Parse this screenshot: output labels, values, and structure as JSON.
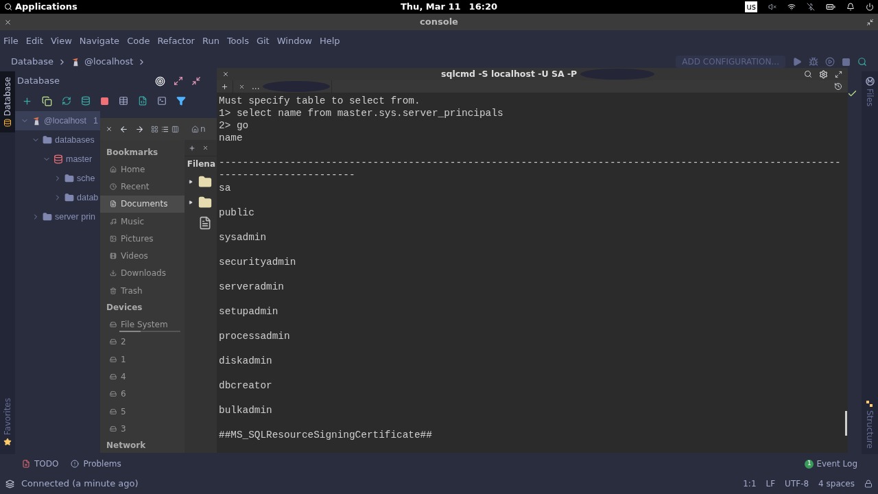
{
  "top_bar": {
    "menu": "Applications",
    "date": "Thu, Mar 11",
    "time": "16:20",
    "keyboard": "us"
  },
  "window": {
    "title": "console"
  },
  "menu": [
    "File",
    "Edit",
    "View",
    "Navigate",
    "Code",
    "Refactor",
    "Run",
    "Tools",
    "Git",
    "Window",
    "Help"
  ],
  "breadcrumb": [
    "Database",
    "@localhost"
  ],
  "run_config": "ADD CONFIGURATION...",
  "left_strip": {
    "top": {
      "label": "Database",
      "selected": true
    },
    "bottom": {
      "label": "Favorites",
      "selected": false
    }
  },
  "right_strip": [
    "Files",
    "Structure"
  ],
  "db_panel": {
    "title": "Database",
    "tree": [
      {
        "kind": "host",
        "label": "@localhost",
        "badge": "1",
        "expanded": true,
        "selected": true,
        "children": [
          {
            "kind": "folder",
            "label": "databases",
            "expanded": true,
            "selected": false,
            "children": [
              {
                "kind": "database",
                "label": "master",
                "expanded": true,
                "selected": false,
                "children": [
                  {
                    "kind": "folder",
                    "label": "sche",
                    "expanded": false,
                    "selected": false
                  },
                  {
                    "kind": "folder",
                    "label": "datab",
                    "expanded": false,
                    "selected": false
                  }
                ]
              }
            ]
          },
          {
            "kind": "folder",
            "label": "server prin",
            "expanded": false,
            "selected": false
          }
        ]
      }
    ]
  },
  "file_manager": {
    "path": "n",
    "column": "Filena",
    "sections": [
      {
        "title": "Bookmarks",
        "items": [
          {
            "label": "Home",
            "selected": false
          },
          {
            "label": "Recent",
            "selected": false
          },
          {
            "label": "Documents",
            "selected": true
          },
          {
            "label": "Music",
            "selected": false
          },
          {
            "label": "Pictures",
            "selected": false
          },
          {
            "label": "Videos",
            "selected": false
          },
          {
            "label": "Downloads",
            "selected": false
          },
          {
            "label": "Trash",
            "selected": false
          }
        ]
      },
      {
        "title": "Devices",
        "items": [
          {
            "label": "File System",
            "selected": false,
            "level": 0.35
          },
          {
            "label": "2",
            "selected": false
          },
          {
            "label": "1",
            "selected": false
          },
          {
            "label": "4",
            "selected": false
          },
          {
            "label": "6",
            "selected": false
          },
          {
            "label": "5",
            "selected": false
          },
          {
            "label": "3",
            "selected": false
          }
        ]
      },
      {
        "title": "Network"
      }
    ],
    "rows": [
      {
        "kind": "folder",
        "expandable": true
      },
      {
        "kind": "folder",
        "expandable": true
      },
      {
        "kind": "document",
        "expandable": false
      }
    ]
  },
  "terminal": {
    "title": "sqlcmd -S localhost -U SA -P",
    "tab": "...",
    "lines": [
      "Must specify table to select from.",
      "1> select name from master.sys.server_principals",
      "2> go",
      "name"
    ],
    "rule": "--------------------------------------------------------------------------------------------------------------------------------",
    "rows": [
      "sa",
      "public",
      "sysadmin",
      "securityadmin",
      "serveradmin",
      "setupadmin",
      "processadmin",
      "diskadmin",
      "dbcreator",
      "bulkadmin",
      "##MS_SQLResourceSigningCertificate##"
    ]
  },
  "tool_tabs": [
    "TODO",
    "Problems"
  ],
  "event_log": {
    "label": "Event Log",
    "badge": "1"
  },
  "status": {
    "message": "Connected (a minute ago)",
    "items": [
      "1:1",
      "LF",
      "UTF-8",
      "4 spaces"
    ]
  }
}
